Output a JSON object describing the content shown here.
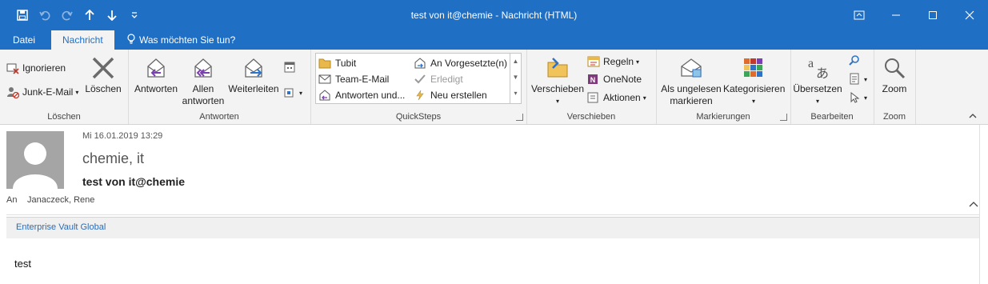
{
  "window": {
    "title": "test von it@chemie - Nachricht (HTML)"
  },
  "quick_access": {
    "save_icon": "save-icon",
    "undo_icon": "undo-icon",
    "redo_icon": "redo-icon",
    "up_icon": "arrow-up-icon",
    "down_icon": "arrow-down-icon",
    "customize_icon": "customize-icon"
  },
  "tabs": {
    "file": "Datei",
    "message": "Nachricht",
    "tellme": "Was möchten Sie tun?"
  },
  "ribbon": {
    "delete_group": {
      "label": "Löschen",
      "ignore": "Ignorieren",
      "junk": "Junk-E-Mail",
      "delete": "Löschen"
    },
    "respond_group": {
      "label": "Antworten",
      "reply": "Antworten",
      "reply_all_1": "Allen",
      "reply_all_2": "antworten",
      "forward": "Weiterleiten"
    },
    "quicksteps_group": {
      "label": "QuickSteps",
      "items": [
        "Tubit",
        "Team-E-Mail",
        "Antworten und...",
        "An Vorgesetzte(n)",
        "Erledigt",
        "Neu erstellen"
      ]
    },
    "move_group": {
      "label": "Verschieben",
      "move": "Verschieben",
      "rules": "Regeln",
      "onenote": "OneNote",
      "actions": "Aktionen"
    },
    "tags_group": {
      "label": "Markierungen",
      "unread_1": "Als ungelesen",
      "unread_2": "markieren",
      "categorize": "Kategorisieren"
    },
    "edit_group": {
      "label": "Bearbeiten",
      "translate": "Übersetzen"
    },
    "zoom_group": {
      "label": "Zoom",
      "zoom": "Zoom"
    }
  },
  "message": {
    "date": "Mi 16.01.2019 13:29",
    "sender": "chemie, it",
    "subject": "test von it@chemie",
    "to_label": "An",
    "to_value": "Janaczeck, Rene",
    "infobar": "Enterprise Vault Global",
    "body": "test"
  },
  "colors": {
    "accent": "#1f6fc5",
    "ribbon_bg": "#f3f3f3",
    "link": "#2b6cb8"
  }
}
